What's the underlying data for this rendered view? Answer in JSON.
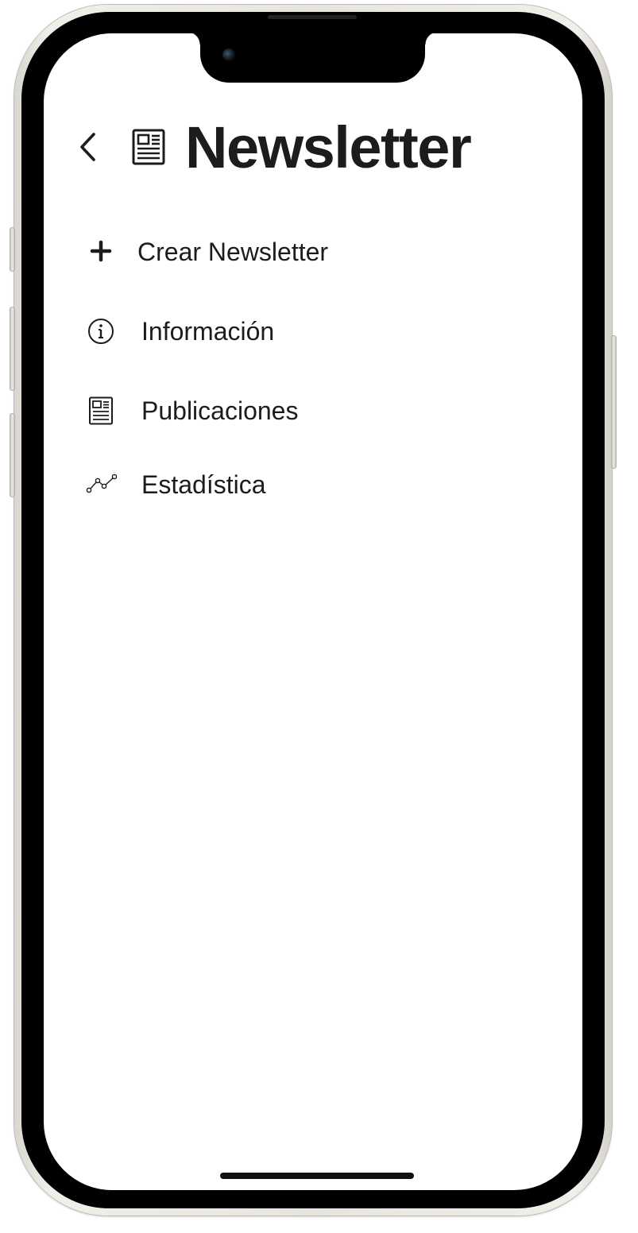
{
  "header": {
    "back_icon": "chevron-left-icon",
    "title_icon": "newspaper-icon",
    "title": "Newsletter"
  },
  "menu": {
    "items": [
      {
        "icon": "plus-icon",
        "label": "Crear Newsletter"
      },
      {
        "icon": "info-circle-icon",
        "label": "Información"
      },
      {
        "icon": "newspaper-icon",
        "label": "Publicaciones"
      },
      {
        "icon": "line-chart-icon",
        "label": "Estadística"
      }
    ]
  },
  "colors": {
    "text": "#1c1c1e",
    "background": "#ffffff",
    "frame": "#e6e4dd"
  }
}
